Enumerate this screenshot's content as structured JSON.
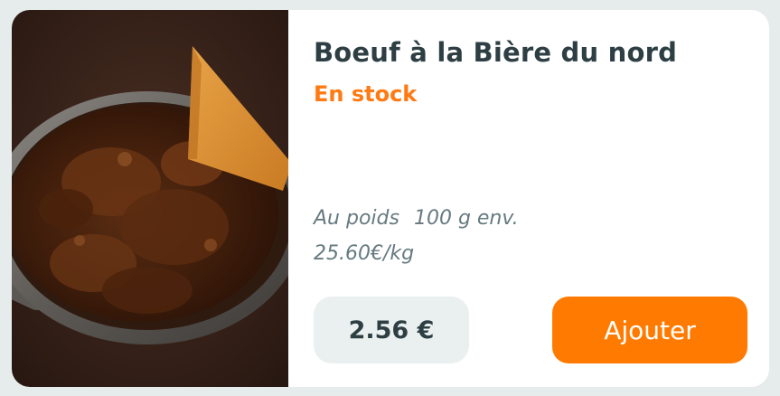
{
  "product": {
    "name": "Boeuf à la Bière du nord",
    "stock_status": "En stock",
    "weight_mode": "Au poids",
    "weight_approx": "100 g env.",
    "price_per_kg": "25.60€/kg",
    "price": "2.56 €",
    "image_icon": "product-photo-beef-stew"
  },
  "actions": {
    "add_label": "Ajouter"
  },
  "colors": {
    "accent": "#ff7a00",
    "title": "#2e3f44",
    "muted": "#667a80",
    "pill_bg": "#eaf0f0"
  }
}
